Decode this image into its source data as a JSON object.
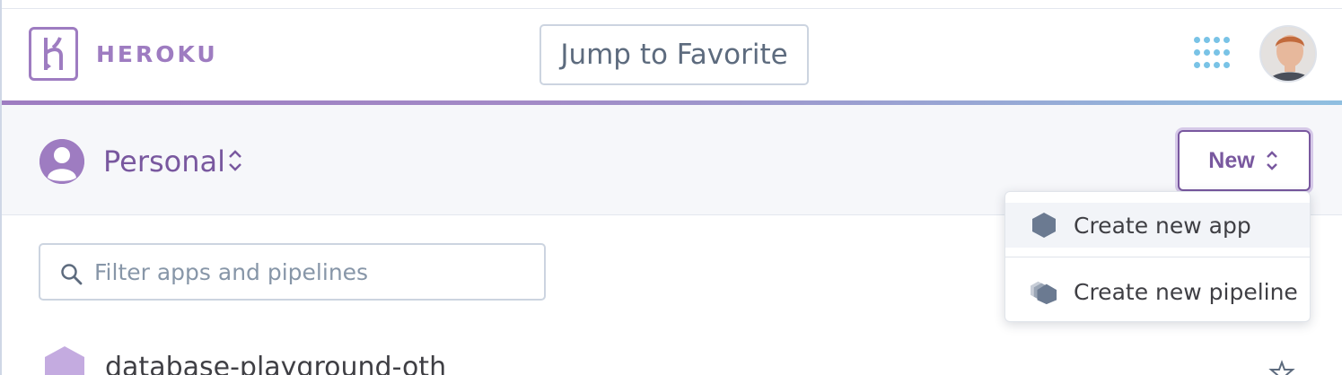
{
  "brand": {
    "name": "HEROKU"
  },
  "header": {
    "jump_label": "Jump to Favorite"
  },
  "account": {
    "label": "Personal"
  },
  "new_button": {
    "label": "New"
  },
  "new_menu": {
    "items": [
      {
        "label": "Create new app",
        "icon": "hexagon-icon"
      },
      {
        "label": "Create new pipeline",
        "icon": "pipeline-icon"
      }
    ]
  },
  "filter": {
    "placeholder": "Filter apps and pipelines",
    "value": ""
  },
  "apps": [
    {
      "name": "database-playground-oth"
    }
  ],
  "colors": {
    "brand_purple": "#79589f",
    "accent_purple": "#9e7cc1",
    "apps_blue": "#79c3e6"
  }
}
